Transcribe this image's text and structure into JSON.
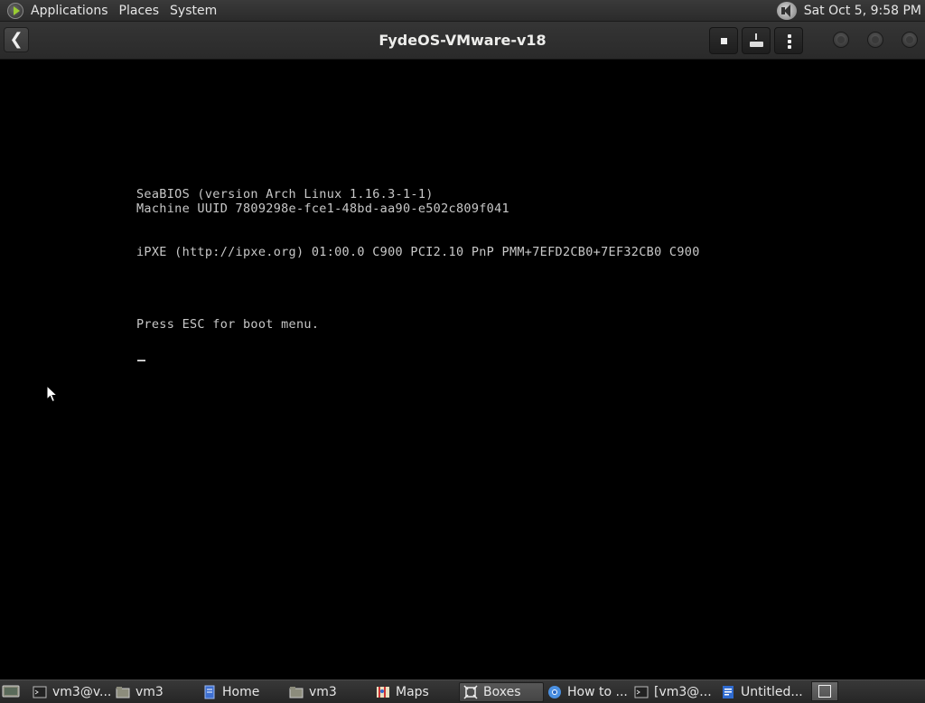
{
  "top_panel": {
    "menu": [
      "Applications",
      "Places",
      "System"
    ],
    "clock": "Sat Oct  5,  9:58 PM"
  },
  "header": {
    "title": "FydeOS-VMware-v18",
    "back_icon": "back-arrow-icon",
    "stop_icon": "stop-icon",
    "keyboard_icon": "send-keys-icon",
    "menu_icon": "more-vertical-icon"
  },
  "console": {
    "lines": [
      "SeaBIOS (version Arch Linux 1.16.3-1-1)",
      "Machine UUID 7809298e-fce1-48bd-aa90-e502c809f041",
      "iPXE (http://ipxe.org) 01:00.0 C900 PCI2.10 PnP PMM+7EFD2CB0+7EF32CB0 C900",
      "Press ESC for boot menu."
    ]
  },
  "taskbar": {
    "tasks": [
      {
        "label": "vm3@v...",
        "icon": "terminal-icon"
      },
      {
        "label": "vm3",
        "icon": "folder-icon"
      },
      {
        "label": "Home",
        "icon": "text-editor-icon"
      },
      {
        "label": "vm3",
        "icon": "folder-icon"
      },
      {
        "label": "Maps",
        "icon": "maps-icon"
      },
      {
        "label": "Boxes",
        "icon": "boxes-icon"
      },
      {
        "label": "How to ...",
        "icon": "chromium-icon"
      },
      {
        "label": "[vm3@...",
        "icon": "terminal-icon"
      },
      {
        "label": "Untitled...",
        "icon": "document-icon"
      }
    ],
    "active_task": "Boxes"
  },
  "colors": {
    "panel_bg": "#2b2b2b",
    "console_bg": "#000000",
    "console_text": "#c8c8c8"
  }
}
